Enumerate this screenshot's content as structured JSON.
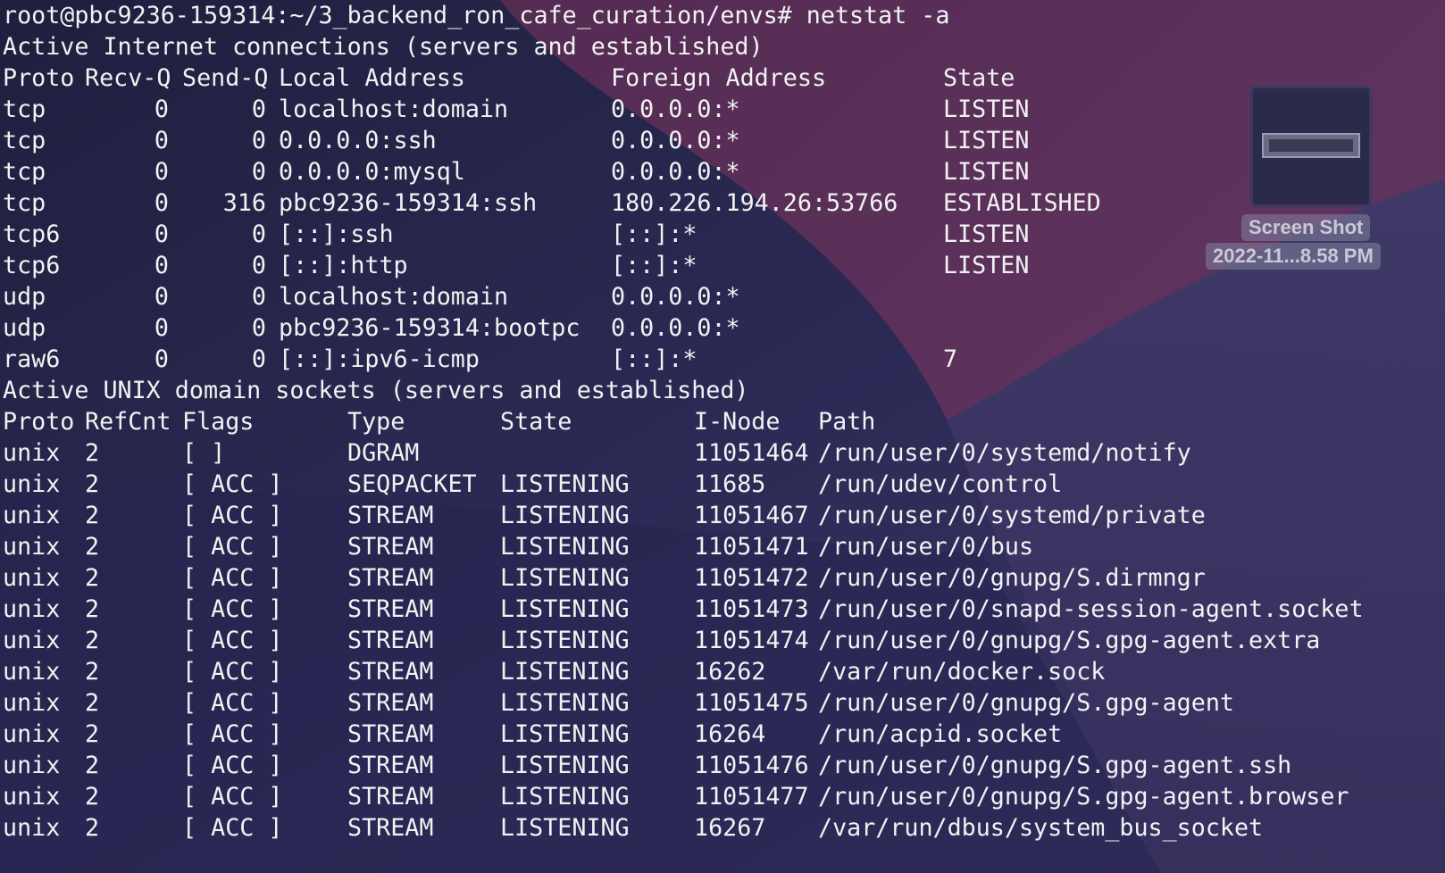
{
  "theme": {
    "text_color": "#f2f2f2",
    "desktop_bg": "#2a2850",
    "accent_wave": "#5a2f5c"
  },
  "terminal": {
    "prompt_line": "root@pbc9236-159314:~/3_backend_ron_cafe_curation/envs# netstat -a",
    "inet_header": "Active Internet connections (servers and established)",
    "inet_columns": {
      "proto": "Proto",
      "recvq": "Recv-Q",
      "sendq": "Send-Q",
      "local": "Local Address",
      "foreign": "Foreign Address",
      "state": "State"
    },
    "inet_rows": [
      {
        "proto": "tcp",
        "recvq": "0",
        "sendq": "0",
        "local": "localhost:domain",
        "foreign": "0.0.0.0:*",
        "state": "LISTEN"
      },
      {
        "proto": "tcp",
        "recvq": "0",
        "sendq": "0",
        "local": "0.0.0.0:ssh",
        "foreign": "0.0.0.0:*",
        "state": "LISTEN"
      },
      {
        "proto": "tcp",
        "recvq": "0",
        "sendq": "0",
        "local": "0.0.0.0:mysql",
        "foreign": "0.0.0.0:*",
        "state": "LISTEN"
      },
      {
        "proto": "tcp",
        "recvq": "0",
        "sendq": "316",
        "local": "pbc9236-159314:ssh",
        "foreign": "180.226.194.26:53766",
        "state": "ESTABLISHED"
      },
      {
        "proto": "tcp6",
        "recvq": "0",
        "sendq": "0",
        "local": "[::]:ssh",
        "foreign": "[::]:*",
        "state": "LISTEN"
      },
      {
        "proto": "tcp6",
        "recvq": "0",
        "sendq": "0",
        "local": "[::]:http",
        "foreign": "[::]:*",
        "state": "LISTEN"
      },
      {
        "proto": "udp",
        "recvq": "0",
        "sendq": "0",
        "local": "localhost:domain",
        "foreign": "0.0.0.0:*",
        "state": ""
      },
      {
        "proto": "udp",
        "recvq": "0",
        "sendq": "0",
        "local": "pbc9236-159314:bootpc",
        "foreign": "0.0.0.0:*",
        "state": ""
      },
      {
        "proto": "raw6",
        "recvq": "0",
        "sendq": "0",
        "local": "[::]:ipv6-icmp",
        "foreign": "[::]:*",
        "state": "7"
      }
    ],
    "unix_header": "Active UNIX domain sockets (servers and established)",
    "unix_columns": {
      "proto": "Proto",
      "refcnt": "RefCnt",
      "flags": "Flags",
      "type": "Type",
      "state": "State",
      "inode": "I-Node",
      "path": "Path"
    },
    "unix_rows": [
      {
        "proto": "unix",
        "refcnt": "2",
        "flags": "[ ]",
        "type": "DGRAM",
        "state": "",
        "inode": "11051464",
        "path": "/run/user/0/systemd/notify"
      },
      {
        "proto": "unix",
        "refcnt": "2",
        "flags": "[ ACC ]",
        "type": "SEQPACKET",
        "state": "LISTENING",
        "inode": "11685",
        "path": "/run/udev/control"
      },
      {
        "proto": "unix",
        "refcnt": "2",
        "flags": "[ ACC ]",
        "type": "STREAM",
        "state": "LISTENING",
        "inode": "11051467",
        "path": "/run/user/0/systemd/private"
      },
      {
        "proto": "unix",
        "refcnt": "2",
        "flags": "[ ACC ]",
        "type": "STREAM",
        "state": "LISTENING",
        "inode": "11051471",
        "path": "/run/user/0/bus"
      },
      {
        "proto": "unix",
        "refcnt": "2",
        "flags": "[ ACC ]",
        "type": "STREAM",
        "state": "LISTENING",
        "inode": "11051472",
        "path": "/run/user/0/gnupg/S.dirmngr"
      },
      {
        "proto": "unix",
        "refcnt": "2",
        "flags": "[ ACC ]",
        "type": "STREAM",
        "state": "LISTENING",
        "inode": "11051473",
        "path": "/run/user/0/snapd-session-agent.socket"
      },
      {
        "proto": "unix",
        "refcnt": "2",
        "flags": "[ ACC ]",
        "type": "STREAM",
        "state": "LISTENING",
        "inode": "11051474",
        "path": "/run/user/0/gnupg/S.gpg-agent.extra"
      },
      {
        "proto": "unix",
        "refcnt": "2",
        "flags": "[ ACC ]",
        "type": "STREAM",
        "state": "LISTENING",
        "inode": "16262",
        "path": "/var/run/docker.sock"
      },
      {
        "proto": "unix",
        "refcnt": "2",
        "flags": "[ ACC ]",
        "type": "STREAM",
        "state": "LISTENING",
        "inode": "11051475",
        "path": "/run/user/0/gnupg/S.gpg-agent"
      },
      {
        "proto": "unix",
        "refcnt": "2",
        "flags": "[ ACC ]",
        "type": "STREAM",
        "state": "LISTENING",
        "inode": "16264",
        "path": "/run/acpid.socket"
      },
      {
        "proto": "unix",
        "refcnt": "2",
        "flags": "[ ACC ]",
        "type": "STREAM",
        "state": "LISTENING",
        "inode": "11051476",
        "path": "/run/user/0/gnupg/S.gpg-agent.ssh"
      },
      {
        "proto": "unix",
        "refcnt": "2",
        "flags": "[ ACC ]",
        "type": "STREAM",
        "state": "LISTENING",
        "inode": "11051477",
        "path": "/run/user/0/gnupg/S.gpg-agent.browser"
      },
      {
        "proto": "unix",
        "refcnt": "2",
        "flags": "[ ACC ]",
        "type": "STREAM",
        "state": "LISTENING",
        "inode": "16267",
        "path": "/var/run/dbus/system_bus_socket"
      }
    ]
  },
  "desktop_icon": {
    "icon": "screenshot-file-icon",
    "label_line1": "Screen Shot",
    "label_line2": "2022-11...8.58 PM"
  }
}
